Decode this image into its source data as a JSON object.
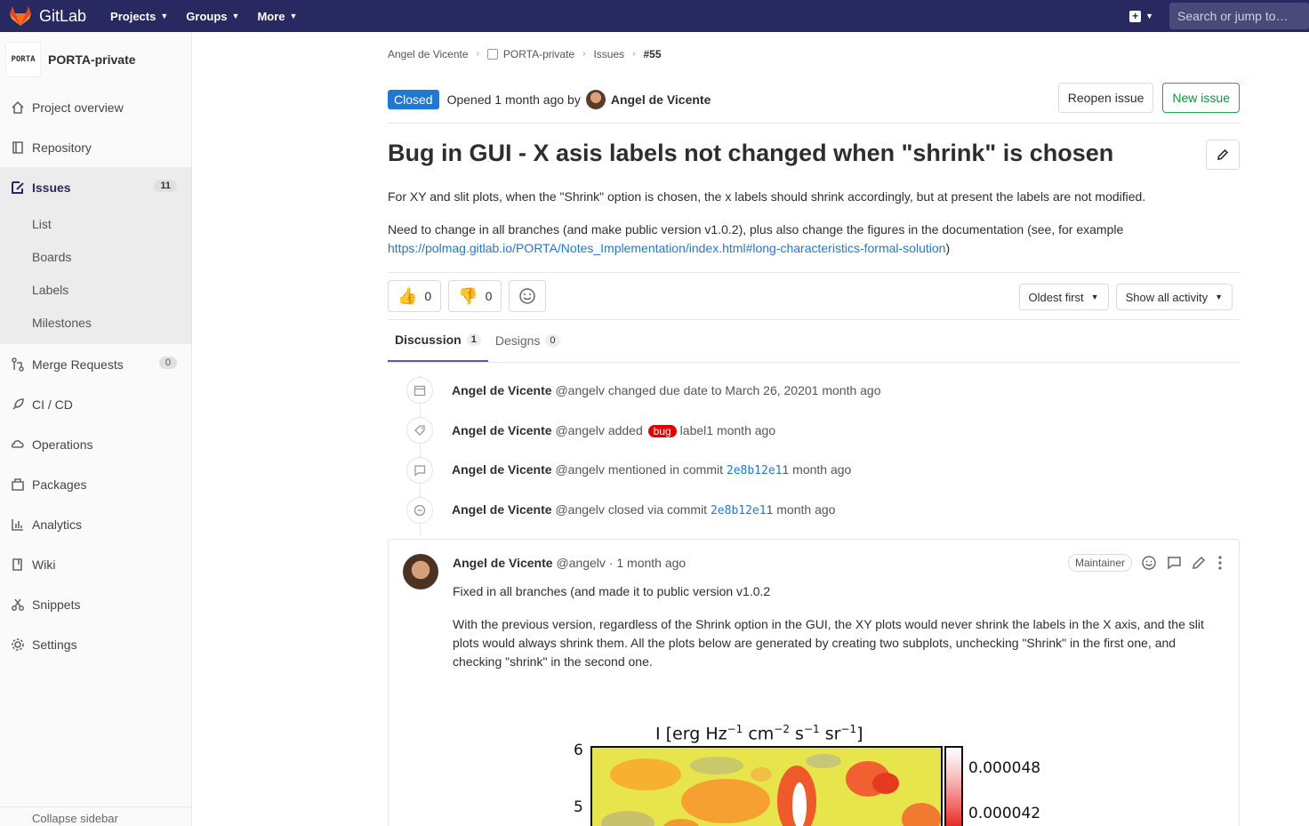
{
  "topnav": {
    "brand": "GitLab",
    "menus": [
      "Projects",
      "Groups",
      "More"
    ],
    "search_placeholder": "Search or jump to…"
  },
  "sidebar": {
    "project_name": "PORTA-private",
    "project_avatar_text": "PORTA",
    "items": [
      {
        "label": "Project overview",
        "icon": "home-icon"
      },
      {
        "label": "Repository",
        "icon": "book-icon"
      },
      {
        "label": "Issues",
        "icon": "issues-icon",
        "count": "11"
      },
      {
        "label": "Merge Requests",
        "icon": "merge-icon",
        "count": "0"
      },
      {
        "label": "CI / CD",
        "icon": "rocket-icon"
      },
      {
        "label": "Operations",
        "icon": "cloud-gear-icon"
      },
      {
        "label": "Packages",
        "icon": "package-icon"
      },
      {
        "label": "Analytics",
        "icon": "chart-icon"
      },
      {
        "label": "Wiki",
        "icon": "wiki-book-icon"
      },
      {
        "label": "Snippets",
        "icon": "scissors-icon"
      },
      {
        "label": "Settings",
        "icon": "gear-icon"
      }
    ],
    "issues_sub": [
      "List",
      "Boards",
      "Labels",
      "Milestones"
    ],
    "collapse_label": "Collapse sidebar"
  },
  "breadcrumb": [
    "Angel de Vicente",
    "PORTA-private",
    "Issues",
    "#55"
  ],
  "issue": {
    "status": "Closed",
    "opened_text": "Opened 1 month ago by",
    "author": "Angel de Vicente",
    "reopen_label": "Reopen issue",
    "new_issue_label": "New issue",
    "title": "Bug in GUI - X asis labels not changed when \"shrink\" is chosen",
    "desc_p1": "For XY and slit plots, when the \"Shrink\" option is chosen, the x labels should shrink accordingly, but at present the labels are not modified.",
    "desc_p2": "Need to change in all branches (and make public version v1.0.2), plus also change the figures in the documentation (see, for example",
    "desc_link": "https://polmag.gitlab.io/PORTA/Notes_Implementation/index.html#long-characteristics-formal-solution",
    "desc_close": ")"
  },
  "awards": {
    "thumbs_up": "0",
    "thumbs_down": "0"
  },
  "sort": {
    "order": "Oldest first",
    "filter": "Show all activity"
  },
  "tabs": [
    {
      "label": "Discussion",
      "count": "1"
    },
    {
      "label": "Designs",
      "count": "0"
    }
  ],
  "activity": [
    {
      "icon": "calendar-icon",
      "user": "Angel de Vicente",
      "handle": "@angelv",
      "text": "changed due date to March 26, 2020",
      "time": "1 month ago"
    },
    {
      "icon": "tag-icon",
      "user": "Angel de Vicente",
      "handle": "@angelv",
      "text": "added",
      "label": "bug",
      "text2": "label",
      "time": "1 month ago"
    },
    {
      "icon": "comment-icon",
      "user": "Angel de Vicente",
      "handle": "@angelv",
      "text": "mentioned in commit",
      "commit": "2e8b12e1",
      "time": "1 month ago"
    },
    {
      "icon": "status-closed-icon",
      "user": "Angel de Vicente",
      "handle": "@angelv",
      "text": "closed via commit",
      "commit": "2e8b12e1",
      "time": "1 month ago"
    }
  ],
  "comment": {
    "user": "Angel de Vicente",
    "meta": "@angelv · 1 month ago",
    "role": "Maintainer",
    "p1": "Fixed in all branches (and made it to public version v1.0.2",
    "p2": "With the previous version, regardless of the Shrink option in the GUI, the XY plots would never shrink the labels in the X axis, and the slit plots would always shrink them. All the plots below are generated by creating two subplots, unchecking \"Shrink\" in the first one, and checking \"shrink\" in the second one.",
    "plot": {
      "title_html_parts": [
        "I [erg Hz",
        "−1",
        " cm",
        "−2",
        " s",
        "−1",
        " sr",
        "−1",
        "]"
      ],
      "y_ticks": [
        "6",
        "5"
      ],
      "colorbar_ticks": [
        "0.000048",
        "0.000042"
      ]
    }
  }
}
